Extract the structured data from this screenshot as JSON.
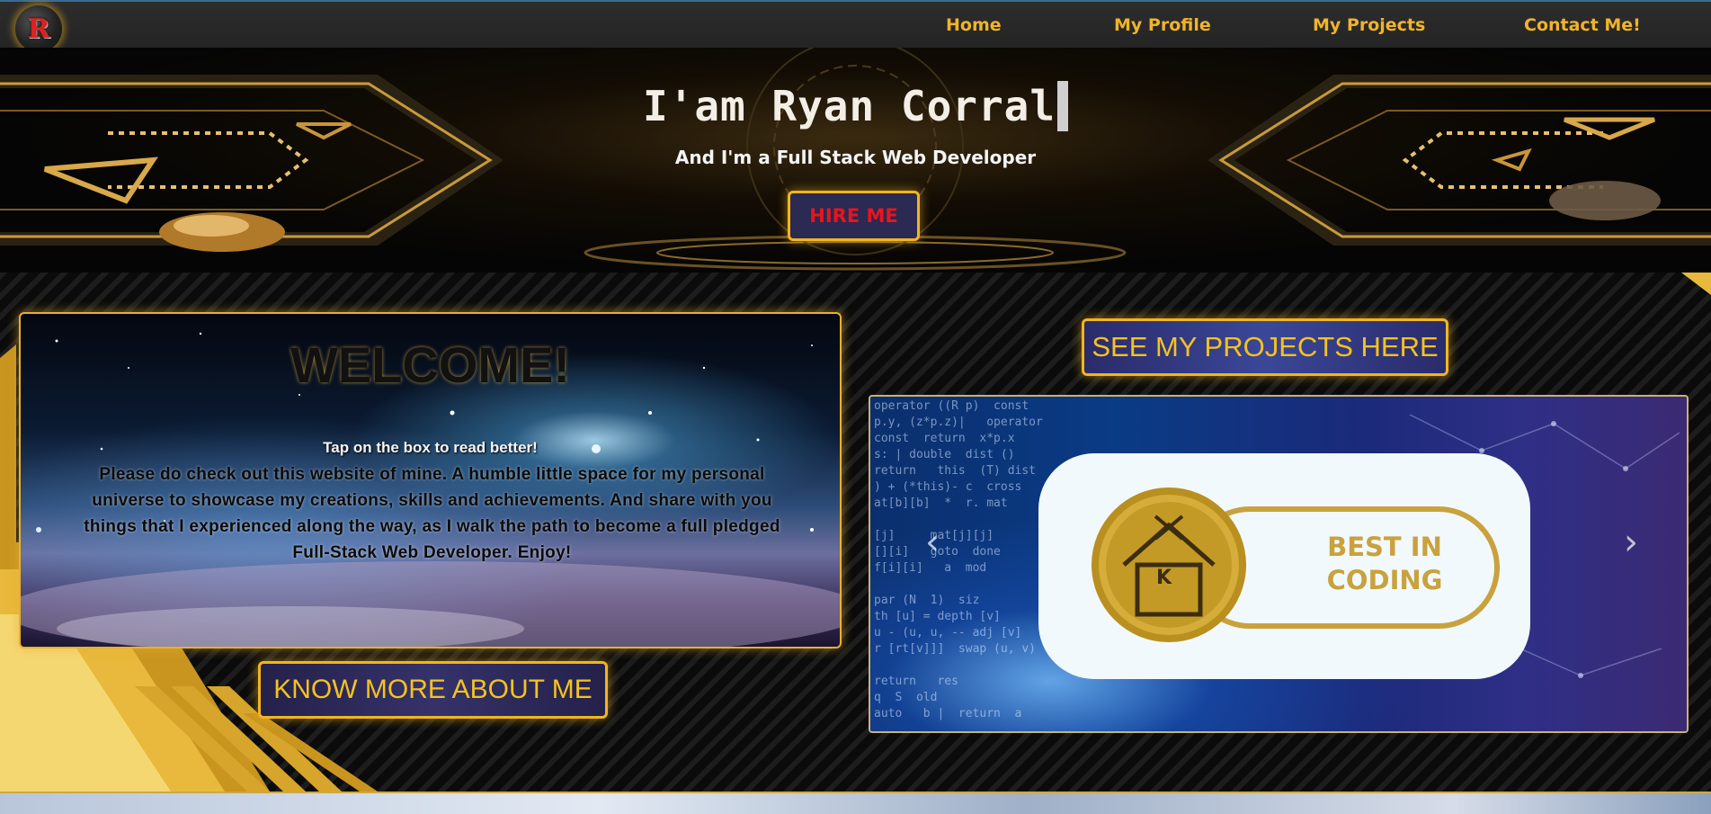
{
  "nav": {
    "logo_letter": "R",
    "links": [
      "Home",
      "My Profile",
      "My Projects",
      "Contact Me!"
    ]
  },
  "hero": {
    "title": "I'am Ryan Corral",
    "subtitle": "And I'm a Full Stack Web Developer",
    "hire_button": "HIRE ME"
  },
  "welcome": {
    "title": "WELCOME!",
    "hint": "Tap on the box to read better!",
    "body": "Please do check out this website of mine. A humble little space for my personal universe to showcase my creations, skills and achievements. And share with you things that I experienced along the way, as I walk the path to become a full pledged Full-Stack Web Developer. Enjoy!"
  },
  "buttons": {
    "know_more": "KNOW MORE ABOUT ME",
    "see_projects": "SEE MY PROJECTS HERE"
  },
  "carousel": {
    "slide_text_line1": "BEST IN",
    "slide_text_line2": "CODING",
    "badge_letter": "K",
    "prev_glyph": "‹",
    "next_glyph": "›"
  },
  "colors": {
    "accent_gold": "#f2b51f",
    "nav_text": "#f0b42a",
    "hire_text": "#e8141e",
    "button_bg": "#2a2a52"
  }
}
